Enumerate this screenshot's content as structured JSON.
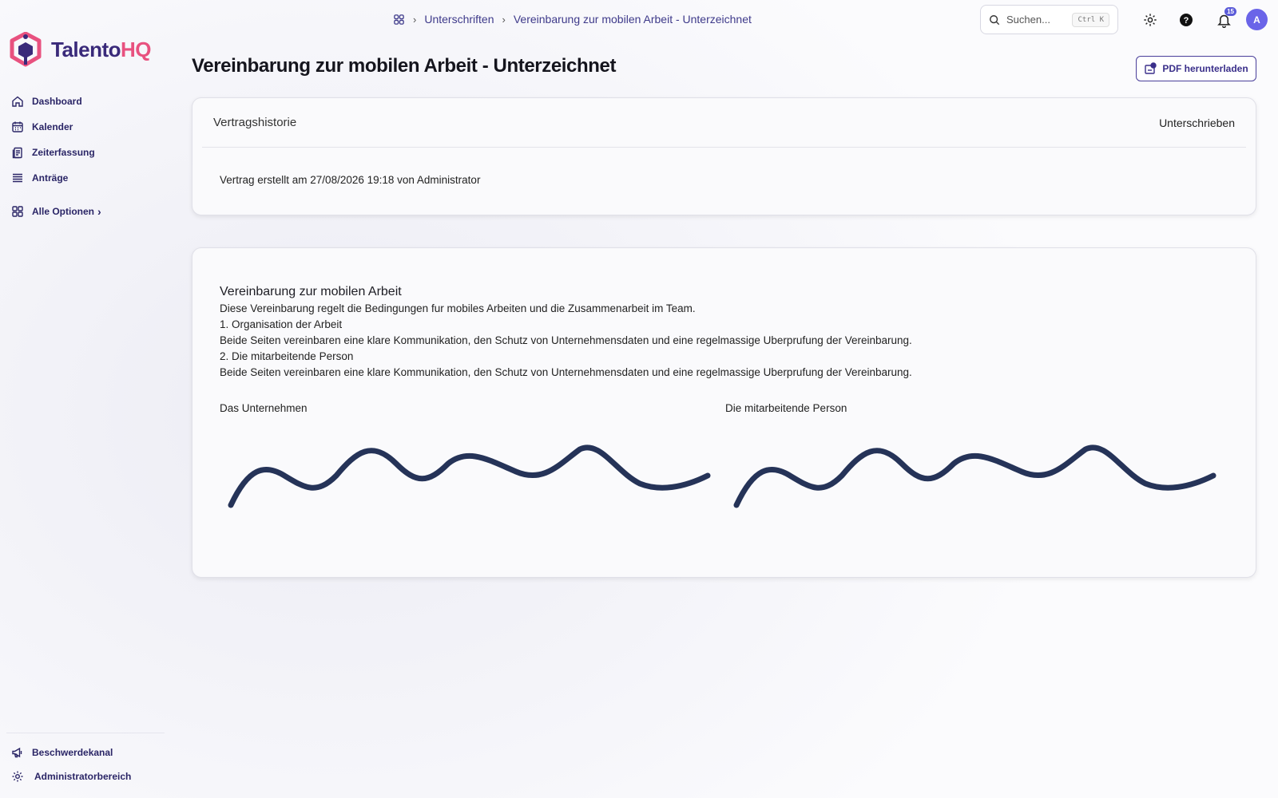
{
  "app": {
    "logo_part1": "Talento",
    "logo_part2": "HQ"
  },
  "sidebar": {
    "items": [
      {
        "label": "Dashboard",
        "icon": "home-icon"
      },
      {
        "label": "Kalender",
        "icon": "calendar-icon"
      },
      {
        "label": "Zeiterfassung",
        "icon": "clipboard-icon"
      },
      {
        "label": "Anträge",
        "icon": "list-icon"
      },
      {
        "label": "Alle Optionen",
        "icon": "grid-icon",
        "chevron": "›"
      }
    ],
    "bottom": [
      {
        "label": "Beschwerdekanal",
        "icon": "megaphone-icon"
      },
      {
        "label": "Administratorbereich",
        "icon": "gear-icon"
      }
    ]
  },
  "breadcrumb": {
    "items": [
      "Unterschriften",
      "Vereinbarung zur mobilen Arbeit - Unterzeichnet"
    ]
  },
  "search": {
    "placeholder": "Suchen...",
    "shortcut": "Ctrl K"
  },
  "notifications": {
    "count": "15"
  },
  "user": {
    "initial": "A"
  },
  "page": {
    "title": "Vereinbarung zur mobilen Arbeit - Unterzeichnet",
    "pdf_button": "PDF herunterladen"
  },
  "history": {
    "title": "Vertragshistorie",
    "status": "Unterschrieben",
    "entry": "Vertrag erstellt am 27/08/2026 19:18 von Administrator"
  },
  "document": {
    "title": "Vereinbarung zur mobilen Arbeit",
    "lines": [
      "Diese Vereinbarung regelt die Bedingungen fur mobiles Arbeiten und die Zusammenarbeit im Team.",
      "1. Organisation der Arbeit",
      "Beide Seiten vereinbaren eine klare Kommunikation, den Schutz von Unternehmensdaten und eine regelmassige Uberprufung der Vereinbarung.",
      "2. Die mitarbeitende Person",
      "Beide Seiten vereinbaren eine klare Kommunikation, den Schutz von Unternehmensdaten und eine regelmassige Uberprufung der Vereinbarung."
    ],
    "signature_company_label": "Das Unternehmen",
    "signature_employee_label": "Die mitarbeitende Person"
  },
  "colors": {
    "accent": "#3a2f8a",
    "brand_pink": "#e8517f",
    "signature": "#253358"
  }
}
